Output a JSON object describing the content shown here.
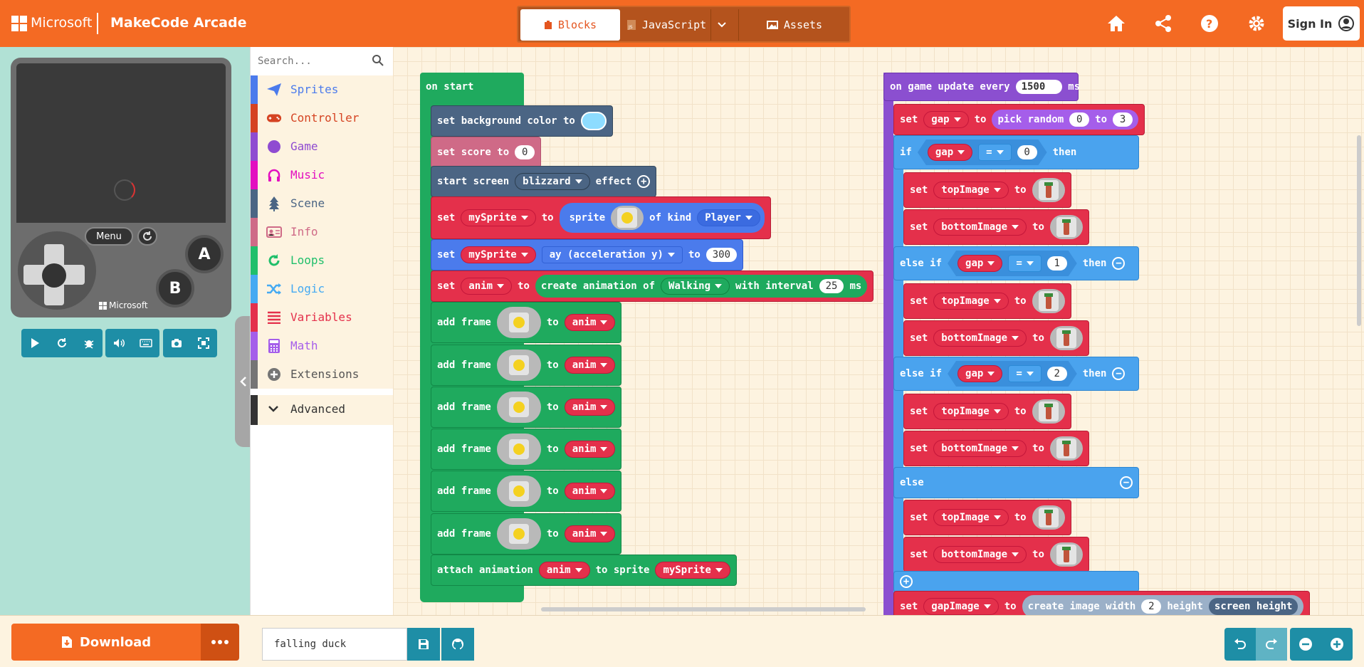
{
  "header": {
    "brand": "Microsoft",
    "app_title": "MakeCode Arcade",
    "tabs": {
      "blocks": "Blocks",
      "javascript": "JavaScript",
      "assets": "Assets"
    },
    "sign_in": "Sign In",
    "icons": [
      "home-icon",
      "share-icon",
      "help-icon",
      "settings-icon",
      "user-icon"
    ],
    "colors": {
      "header_bg": "#f46a23",
      "accent": "#1e8ea6"
    }
  },
  "simulator": {
    "menu": "Menu",
    "a": "A",
    "b": "B",
    "brand": "Microsoft",
    "buttons": [
      "play-icon",
      "restart-icon",
      "debug-icon",
      "sound-icon",
      "keyboard-icon",
      "screenshot-icon",
      "fullscreen-icon"
    ]
  },
  "toolbox": {
    "search_placeholder": "Search...",
    "categories": [
      {
        "label": "Sprites",
        "color": "#4b7bec"
      },
      {
        "label": "Controller",
        "color": "#d54322"
      },
      {
        "label": "Game",
        "color": "#8f4bd1"
      },
      {
        "label": "Music",
        "color": "#e30fc0"
      },
      {
        "label": "Scene",
        "color": "#4b6584"
      },
      {
        "label": "Info",
        "color": "#cf6a87"
      },
      {
        "label": "Loops",
        "color": "#20bf6b"
      },
      {
        "label": "Logic",
        "color": "#45aaf2"
      },
      {
        "label": "Variables",
        "color": "#e4304b"
      },
      {
        "label": "Math",
        "color": "#a55eea"
      },
      {
        "label": "Extensions",
        "color": "#757575"
      }
    ],
    "advanced": "Advanced"
  },
  "blocks": {
    "on_start": {
      "title": "on start",
      "set_bg": "set background color to",
      "set_score": "set score to",
      "score_value": "0",
      "start_screen": "start screen",
      "effect_value": "blizzard",
      "effect": "effect",
      "set": "set",
      "to": "to",
      "my_sprite": "mySprite",
      "sprite": "sprite",
      "of_kind": "of kind",
      "kind_value": "Player",
      "ay_value": "ay (acceleration y)",
      "ay_number": "300",
      "anim": "anim",
      "create_anim": "create animation of",
      "walking": "Walking",
      "with_interval": "with interval",
      "interval_value": "25",
      "ms": "ms",
      "add_frame": "add frame",
      "attach_animation": "attach animation",
      "to_sprite": "to sprite"
    },
    "on_update": {
      "title": "on game update every",
      "period": "1500",
      "ms": "ms",
      "set": "set",
      "gap": "gap",
      "to": "to",
      "pick_random": "pick random",
      "rand_min": "0",
      "rand_max": "3",
      "if": "if",
      "else_if": "else if",
      "else": "else",
      "then": "then",
      "eq": "=",
      "v0": "0",
      "v1": "1",
      "v2": "2",
      "top_image": "topImage",
      "bottom_image": "bottomImage",
      "gap_image": "gapImage",
      "create_image": "create image width",
      "width_value": "2",
      "height": "height",
      "screen_height": "screen height"
    }
  },
  "footer": {
    "download": "Download",
    "project_name": "falling duck"
  }
}
